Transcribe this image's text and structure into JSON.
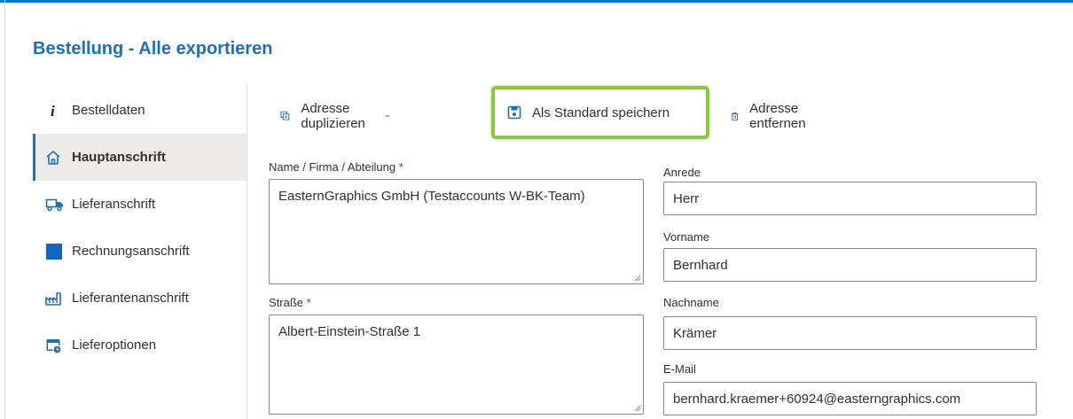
{
  "header": {
    "title": "Bestellung - Alle exportieren"
  },
  "sidebar": {
    "items": [
      {
        "label": "Bestelldaten",
        "icon": "info-icon"
      },
      {
        "label": "Hauptanschrift",
        "icon": "home-icon"
      },
      {
        "label": "Lieferanschrift",
        "icon": "truck-icon"
      },
      {
        "label": "Rechnungsanschrift",
        "icon": "square-icon"
      },
      {
        "label": "Lieferantenanschrift",
        "icon": "factory-icon"
      },
      {
        "label": "Lieferoptionen",
        "icon": "calendar-clock-icon"
      }
    ],
    "active": "Hauptanschrift"
  },
  "toolbar": {
    "duplicate_label": "Adresse duplizieren",
    "save_default_label": "Als Standard speichern",
    "remove_label": "Adresse entfernen"
  },
  "form": {
    "name": {
      "label": "Name / Firma / Abteilung",
      "required_mark": "*",
      "value": "EasternGraphics GmbH (Testaccounts W-BK-Team)"
    },
    "street": {
      "label": "Straße",
      "required_mark": "*",
      "value": "Albert-Einstein-Straße 1"
    },
    "salutation": {
      "label": "Anrede",
      "value": "Herr"
    },
    "firstname": {
      "label": "Vorname",
      "value": "Bernhard"
    },
    "lastname": {
      "label": "Nachname",
      "value": "Krämer"
    },
    "email": {
      "label": "E-Mail",
      "value": "bernhard.kraemer+60924@easterngraphics.com"
    }
  },
  "colors": {
    "accent": "#1e6fb8",
    "highlight": "#8dc63f",
    "topbar": "#0078d4"
  }
}
